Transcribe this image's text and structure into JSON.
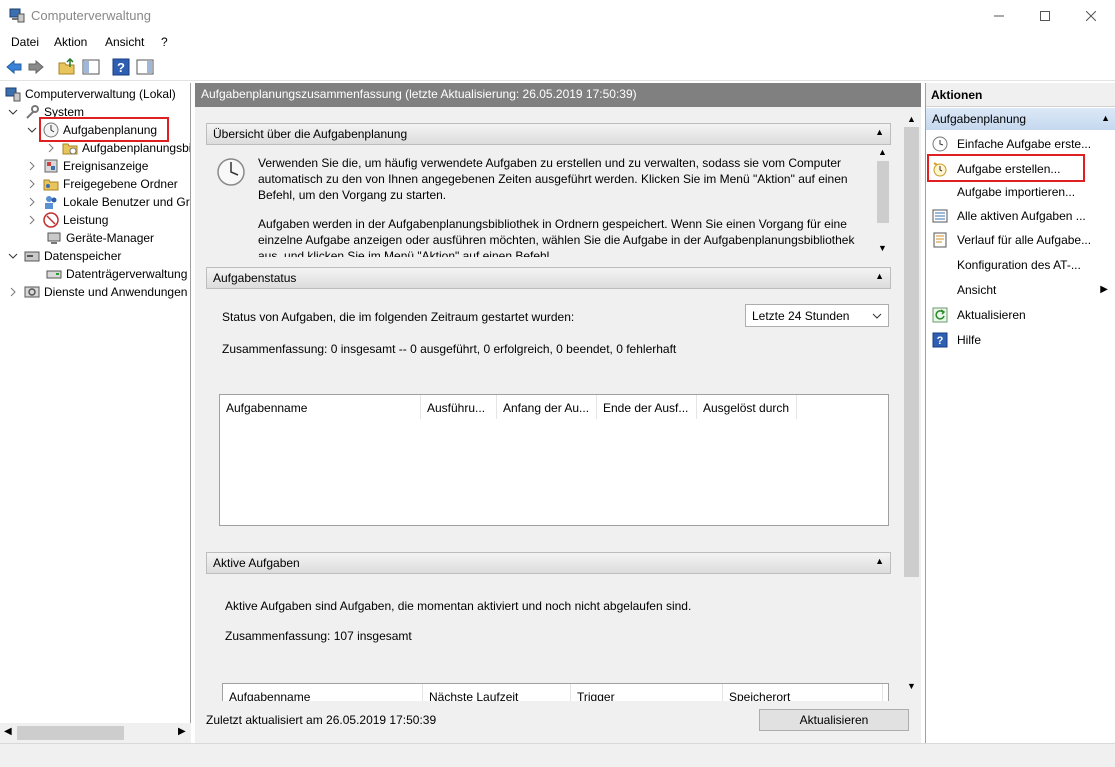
{
  "window": {
    "title": "Computerverwaltung"
  },
  "menu": {
    "items": [
      "Datei",
      "Aktion",
      "Ansicht",
      "?"
    ]
  },
  "tree": {
    "root": "Computerverwaltung (Lokal)",
    "system": "System",
    "scheduler": "Aufgabenplanung",
    "scheduler_lib": "Aufgabenplanungsbibliothek",
    "events": "Ereignisanzeige",
    "shares": "Freigegebene Ordner",
    "users": "Lokale Benutzer und Gruppen",
    "perf": "Leistung",
    "devmgr": "Geräte-Manager",
    "storage": "Datenspeicher",
    "diskmgmt": "Datenträgerverwaltung",
    "services": "Dienste und Anwendungen"
  },
  "center": {
    "header": "Aufgabenplanungszusammenfassung (letzte Aktualisierung: 26.05.2019 17:50:39)",
    "overview": {
      "title": "Übersicht über die Aufgabenplanung",
      "p1_l1": "Verwenden Sie die, um häufig verwendete Aufgaben zu erstellen und zu verwalten, sodass sie vom Computer",
      "p1_l2": "automatisch zu den von Ihnen angegebenen Zeiten ausgeführt werden. Klicken Sie im Menü \"Aktion\" auf einen",
      "p1_l3": "Befehl, um den Vorgang zu starten.",
      "p2_l1": "Aufgaben werden in der Aufgabenplanungsbibliothek in Ordnern gespeichert. Wenn Sie einen Vorgang für eine",
      "p2_l2": "einzelne Aufgabe anzeigen oder ausführen möchten, wählen Sie die Aufgabe in der Aufgabenplanungsbibliothek",
      "p2_l3": "aus, und klicken Sie im Menü \"Aktion\" auf einen Befehl."
    },
    "status": {
      "title": "Aufgabenstatus",
      "label": "Status von Aufgaben, die im folgenden Zeitraum gestartet wurden:",
      "period": "Letzte 24 Stunden",
      "summary": "Zusammenfassung: 0 insgesamt -- 0 ausgeführt, 0 erfolgreich, 0 beendet, 0 fehlerhaft",
      "columns": [
        "Aufgabenname",
        "Ausführu...",
        "Anfang der Au...",
        "Ende der Ausf...",
        "Ausgelöst durch"
      ]
    },
    "active": {
      "title": "Aktive Aufgaben",
      "desc": "Aktive Aufgaben sind Aufgaben, die momentan aktiviert und noch nicht abgelaufen sind.",
      "summary": "Zusammenfassung: 107 insgesamt",
      "columns": [
        "Aufgabenname",
        "Nächste Laufzeit",
        "Trigger",
        "Speicherort"
      ]
    },
    "footer": {
      "last_updated": "Zuletzt aktualisiert am 26.05.2019 17:50:39",
      "refresh": "Aktualisieren"
    }
  },
  "actions": {
    "title": "Aktionen",
    "group": "Aufgabenplanung",
    "items": [
      "Einfache Aufgabe erste...",
      "Aufgabe erstellen...",
      "Aufgabe importieren...",
      "Alle aktiven Aufgaben ...",
      "Verlauf für alle Aufgabe...",
      "Konfiguration des AT-...",
      "Ansicht",
      "Aktualisieren",
      "Hilfe"
    ]
  },
  "colors": {
    "highlight_box": "#e02020",
    "header_gray": "#808080",
    "action_group": "#c5d8ef"
  }
}
